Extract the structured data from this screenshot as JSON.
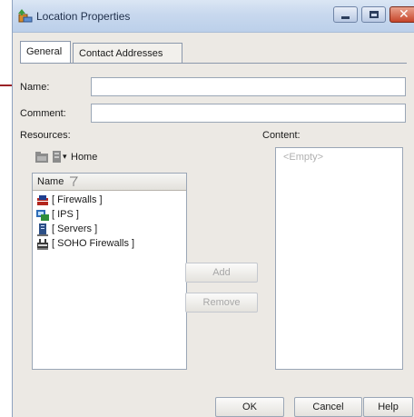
{
  "window": {
    "title": "Location Properties"
  },
  "tabs": [
    {
      "label": "General"
    },
    {
      "label": "Contact Addresses"
    }
  ],
  "form": {
    "name_label": "Name:",
    "name_value": "",
    "comment_label": "Comment:",
    "comment_value": "",
    "resources_label": "Resources:",
    "content_label": "Content:"
  },
  "resources": {
    "location": "Home",
    "column_header": "Name",
    "items": [
      {
        "label": "[ Firewalls ]",
        "icon": "firewall-icon"
      },
      {
        "label": "[ IPS ]",
        "icon": "ips-icon"
      },
      {
        "label": "[ Servers ]",
        "icon": "server-icon"
      },
      {
        "label": "[ SOHO Firewalls ]",
        "icon": "soho-firewall-icon"
      }
    ]
  },
  "content": {
    "empty_text": "<Empty>"
  },
  "buttons": {
    "add": "Add",
    "remove": "Remove",
    "ok": "OK",
    "cancel": "Cancel",
    "help": "Help"
  },
  "colors": {
    "pointer_line": "#9b2226",
    "window_bg": "#ece9e4",
    "titlebar": "#c8d8ee",
    "close_button": "#c7452a"
  }
}
